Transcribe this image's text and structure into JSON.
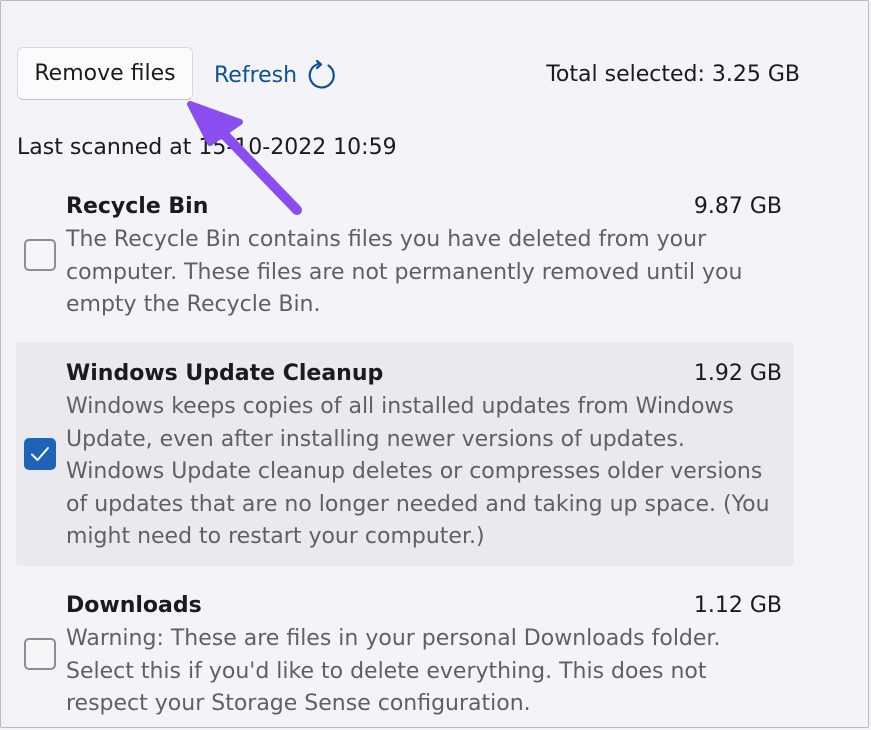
{
  "toolbar": {
    "remove_label": "Remove files",
    "refresh_label": "Refresh",
    "total_selected": "Total selected: 3.25 GB"
  },
  "last_scanned": "Last scanned at 15-10-2022 10:59",
  "items": [
    {
      "name": "Recycle Bin",
      "size": "9.87 GB",
      "checked": false,
      "description": "The Recycle Bin contains files you have deleted from your computer. These files are not permanently removed until you empty the Recycle Bin."
    },
    {
      "name": "Windows Update Cleanup",
      "size": "1.92 GB",
      "checked": true,
      "description": "Windows keeps copies of all installed updates from Windows Update, even after installing newer versions of updates. Windows Update cleanup deletes or compresses older versions of updates that are no longer needed and taking up space. (You might need to restart your computer.)"
    },
    {
      "name": "Downloads",
      "size": "1.12 GB",
      "checked": false,
      "description": "Warning: These are files in your personal Downloads folder. Select this if you'd like to delete everything. This does not respect your Storage Sense configuration."
    }
  ],
  "colors": {
    "accent": "#1e63b8",
    "link": "#0f4f97",
    "annotation_arrow": "#8a4df0"
  },
  "icons": {
    "refresh": "refresh-icon",
    "check": "checkmark-icon",
    "annotation": "pointer-arrow-icon"
  }
}
